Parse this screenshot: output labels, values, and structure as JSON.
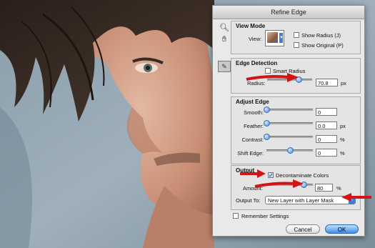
{
  "dialog": {
    "title": "Refine Edge"
  },
  "colors": {
    "accent_blue": "#3f8be0",
    "annotation_red": "#d21414"
  },
  "icons": [
    "zoom-icon",
    "hand-icon",
    "refine-radius-brush-icon"
  ],
  "view_mode": {
    "title": "View Mode",
    "view_label": "View:",
    "show_radius": {
      "label": "Show Radius (J)",
      "checked": false
    },
    "show_original": {
      "label": "Show Original (P)",
      "checked": false
    }
  },
  "edge_detection": {
    "title": "Edge Detection",
    "smart_radius": {
      "label": "Smart Radius",
      "checked": false
    },
    "radius": {
      "label": "Radius:",
      "value": "70.8",
      "unit": "px",
      "slider_fraction": 0.7
    }
  },
  "adjust_edge": {
    "title": "Adjust Edge",
    "smooth": {
      "label": "Smooth:",
      "value": "0",
      "unit": "",
      "slider_fraction": 0.0
    },
    "feather": {
      "label": "Feather:",
      "value": "0.0",
      "unit": "px",
      "slider_fraction": 0.0
    },
    "contrast": {
      "label": "Contrast:",
      "value": "0",
      "unit": "%",
      "slider_fraction": 0.0
    },
    "shift_edge": {
      "label": "Shift Edge:",
      "value": "0",
      "unit": "%",
      "slider_fraction": 0.5
    }
  },
  "output": {
    "title": "Output",
    "decontaminate": {
      "label": "Decontaminate Colors",
      "checked": true
    },
    "amount": {
      "label": "Amount:",
      "value": "80",
      "unit": "%",
      "slider_fraction": 0.8
    },
    "output_to": {
      "label": "Output To:",
      "value": "New Layer with Layer Mask"
    }
  },
  "remember_settings": {
    "label": "Remember Settings",
    "checked": false
  },
  "buttons": {
    "cancel": "Cancel",
    "ok": "OK"
  }
}
